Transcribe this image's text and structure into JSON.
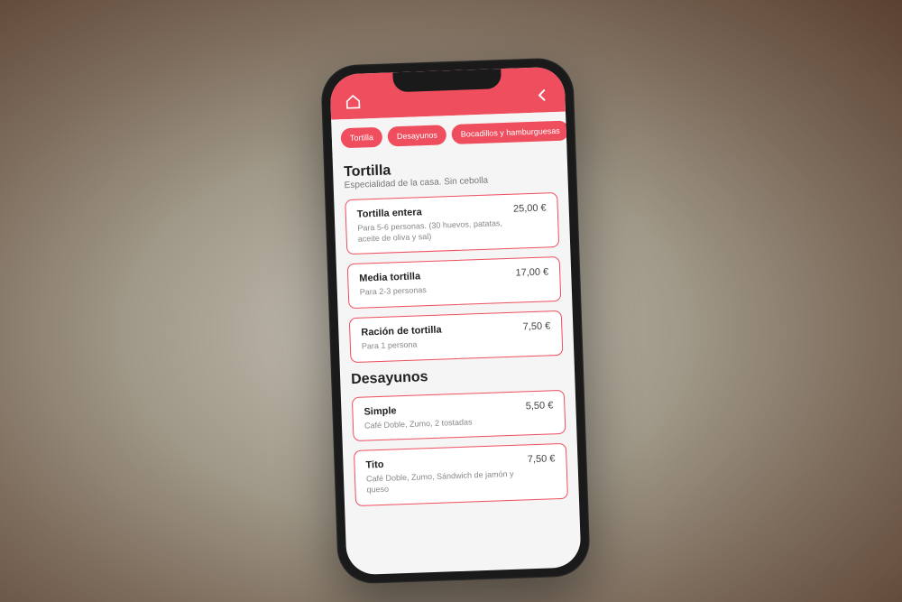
{
  "colors": {
    "accent": "#ef4e5e"
  },
  "tabs": [
    {
      "label": "Tortilla"
    },
    {
      "label": "Desayunos"
    },
    {
      "label": "Bocadillos y hamburguesas"
    }
  ],
  "sections": [
    {
      "title": "Tortilla",
      "description": "Especialidad de la casa. Sin cebolla",
      "items": [
        {
          "name": "Tortilla entera",
          "price": "25,00 €",
          "description": "Para 5-6 personas. (30 huevos, patatas, aceite de oliva y sal)"
        },
        {
          "name": "Media tortilla",
          "price": "17,00 €",
          "description": "Para 2-3 personas"
        },
        {
          "name": "Ración de tortilla",
          "price": "7,50 €",
          "description": "Para 1 persona"
        }
      ]
    },
    {
      "title": "Desayunos",
      "description": "",
      "items": [
        {
          "name": "Simple",
          "price": "5,50 €",
          "description": "Café Doble, Zumo, 2 tostadas"
        },
        {
          "name": "Tito",
          "price": "7,50 €",
          "description": "Café Doble, Zumo, Sándwich de jamón y queso"
        }
      ]
    }
  ]
}
